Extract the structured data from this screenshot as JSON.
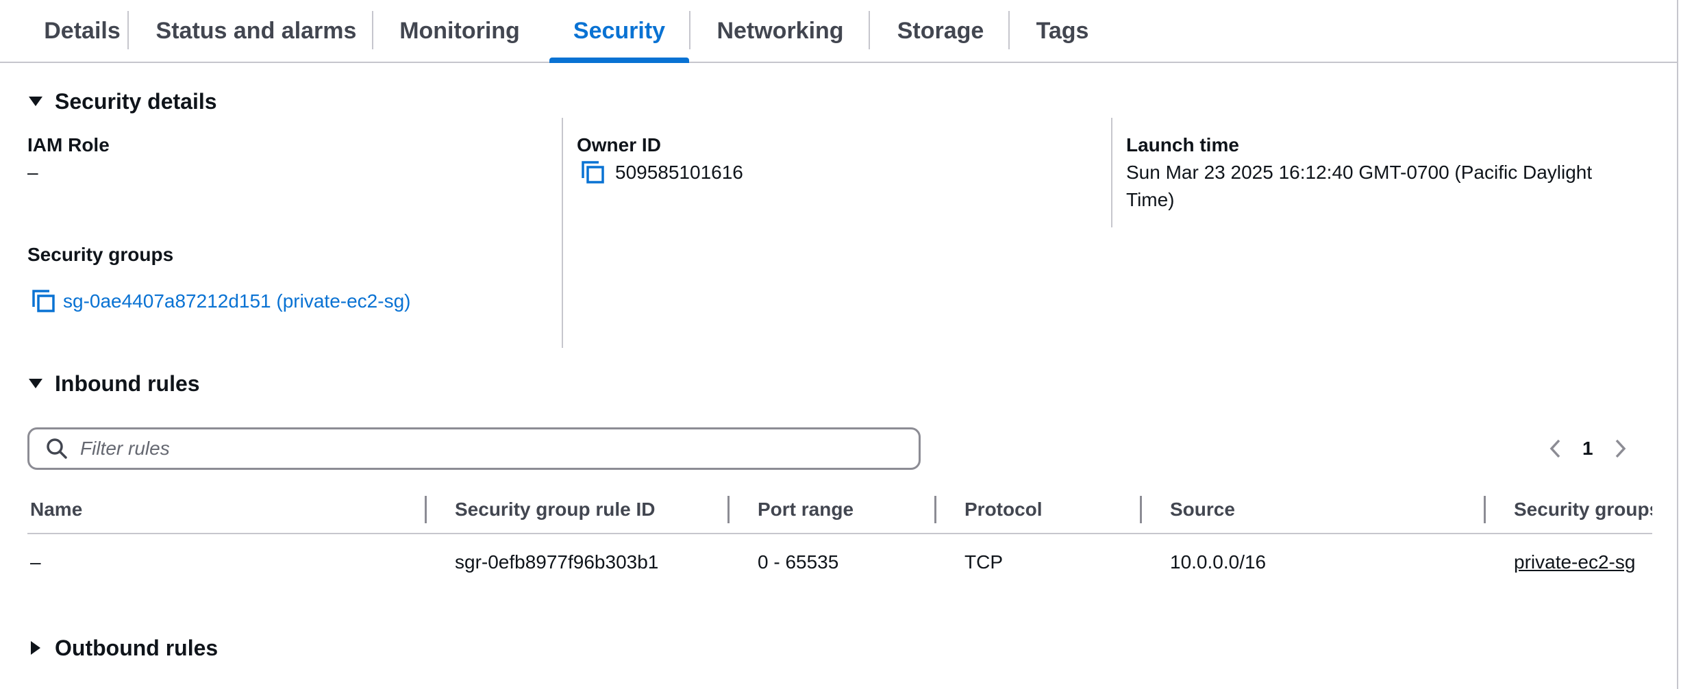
{
  "tabs": [
    {
      "label": "Details"
    },
    {
      "label": "Status and alarms"
    },
    {
      "label": "Monitoring"
    },
    {
      "label": "Security"
    },
    {
      "label": "Networking"
    },
    {
      "label": "Storage"
    },
    {
      "label": "Tags"
    }
  ],
  "active_tab": "Security",
  "accent_color": "#0972d3",
  "security_details": {
    "title": "Security details",
    "iam_role": {
      "label": "IAM Role",
      "value": "–"
    },
    "owner_id": {
      "label": "Owner ID",
      "value": "509585101616"
    },
    "launch_time": {
      "label": "Launch time",
      "value": "Sun Mar 23 2025 16:12:40 GMT-0700 (Pacific Daylight Time)"
    },
    "security_groups": {
      "label": "Security groups",
      "value": "sg-0ae4407a87212d151 (private-ec2-sg)"
    }
  },
  "inbound_rules": {
    "title": "Inbound rules",
    "filter_placeholder": "Filter rules",
    "filter_value": "",
    "page": "1",
    "columns": [
      "Name",
      "Security group rule ID",
      "Port range",
      "Protocol",
      "Source",
      "Security groups"
    ],
    "rows": [
      {
        "name": "–",
        "rule_id": "sgr-0efb8977f96b303b1",
        "port_range": "0 - 65535",
        "protocol": "TCP",
        "source": "10.0.0.0/16",
        "security_groups": "private-ec2-sg"
      }
    ]
  },
  "outbound_rules": {
    "title": "Outbound rules"
  },
  "icons": {
    "copy": "copy-icon",
    "search": "search-icon",
    "expanded": "caret-down-icon",
    "collapsed": "caret-right-icon",
    "prev": "chevron-left-icon",
    "next": "chevron-right-icon"
  }
}
